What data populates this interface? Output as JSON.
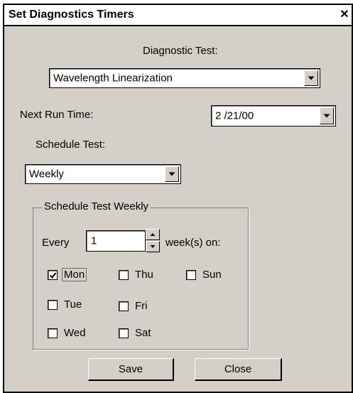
{
  "window": {
    "title": "Set Diagnostics Timers",
    "close_glyph": "✕"
  },
  "diagnostic_test": {
    "label": "Diagnostic Test:",
    "value": "Wavelength Linearization"
  },
  "next_run": {
    "label": "Next Run Time:",
    "value": "2 /21/00"
  },
  "schedule": {
    "label": "Schedule Test:",
    "value": "Weekly"
  },
  "weekly_group": {
    "title": "Schedule Test Weekly",
    "every_label": "Every",
    "every_value": "1",
    "suffix_label": "week(s) on:",
    "days": [
      {
        "label": "Mon",
        "checked": true
      },
      {
        "label": "Thu",
        "checked": false
      },
      {
        "label": "Sun",
        "checked": false
      },
      {
        "label": "Tue",
        "checked": false
      },
      {
        "label": "Fri",
        "checked": false
      },
      {
        "label": "Wed",
        "checked": false
      },
      {
        "label": "Sat",
        "checked": false
      }
    ]
  },
  "buttons": {
    "save": "Save",
    "close": "Close"
  },
  "colors": {
    "face": "#d4d0c8",
    "border": "#000000",
    "field": "#ffffff"
  }
}
